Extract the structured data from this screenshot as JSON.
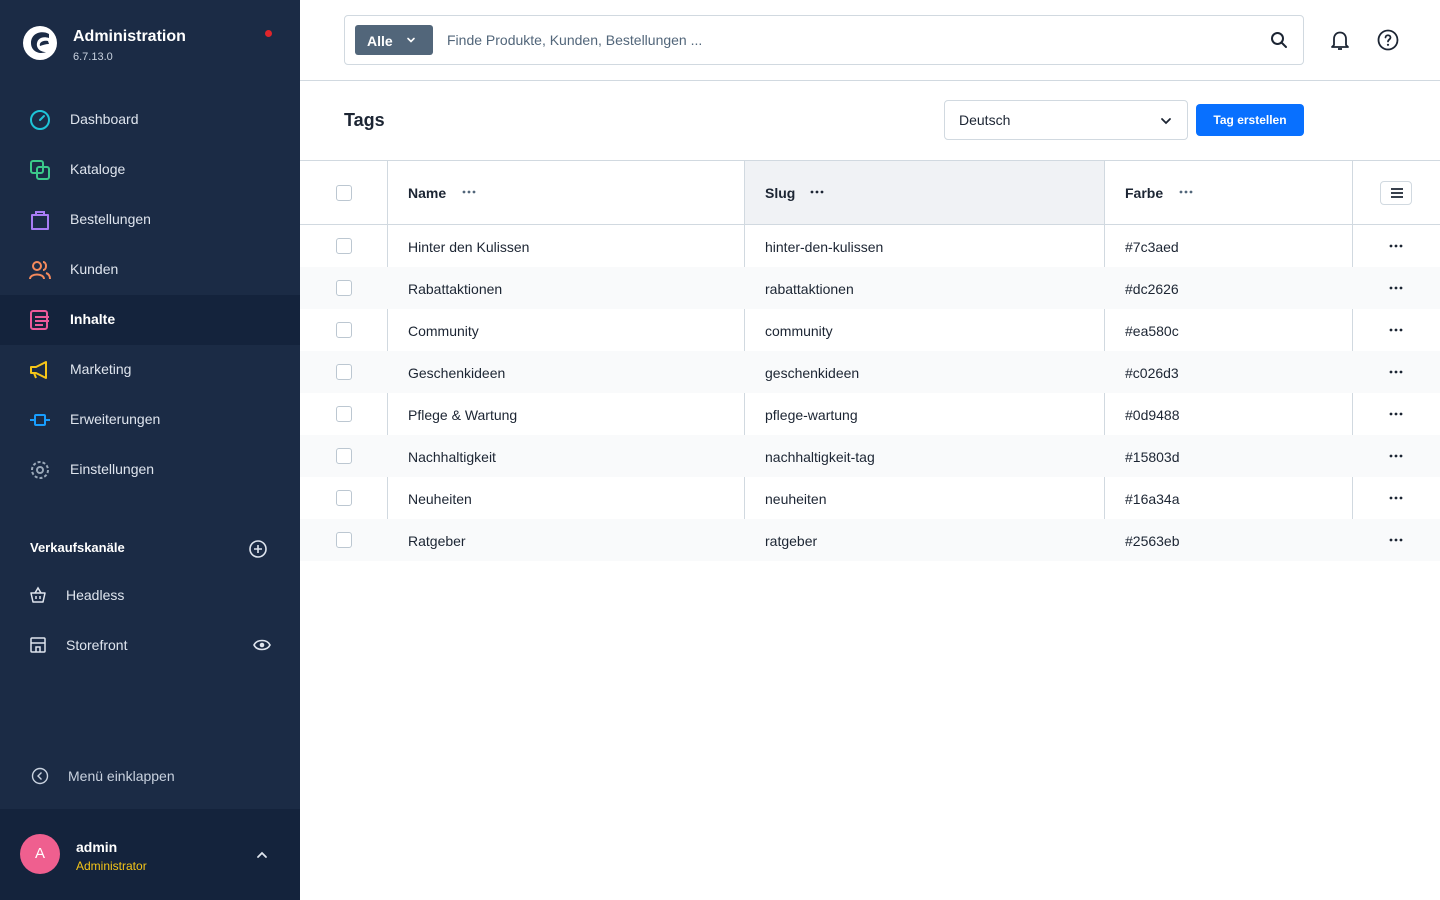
{
  "sidebar": {
    "brand_title": "Administration",
    "brand_version": "6.7.13.0",
    "items": [
      {
        "label": "Dashboard",
        "icon": "dashboard-icon",
        "color": "#1ec4d8"
      },
      {
        "label": "Kataloge",
        "icon": "catalogue-icon",
        "color": "#3bc98a"
      },
      {
        "label": "Bestellungen",
        "icon": "shopping-bag-icon",
        "color": "#a97cf5"
      },
      {
        "label": "Kunden",
        "icon": "users-icon",
        "color": "#f58a5c"
      },
      {
        "label": "Inhalte",
        "icon": "content-icon",
        "color": "#ec5a9a"
      },
      {
        "label": "Marketing",
        "icon": "megaphone-icon",
        "color": "#f5c518"
      },
      {
        "label": "Erweiterungen",
        "icon": "plug-icon",
        "color": "#189eff"
      },
      {
        "label": "Einstellungen",
        "icon": "gear-icon",
        "color": "#9aa8b8"
      }
    ],
    "active_item": "Inhalte",
    "sales_channels_title": "Verkaufskanäle",
    "channels": [
      {
        "label": "Headless",
        "icon": "basket-icon"
      },
      {
        "label": "Storefront",
        "icon": "storefront-icon"
      }
    ],
    "collapse_label": "Menü einklappen",
    "user": {
      "initial": "A",
      "name": "admin",
      "role": "Administrator"
    }
  },
  "search": {
    "type_label": "Alle",
    "placeholder": "Finde Produkte, Kunden, Bestellungen ..."
  },
  "page": {
    "title": "Tags",
    "language": "Deutsch",
    "create_label": "Tag erstellen"
  },
  "grid": {
    "columns": [
      "Name",
      "Slug",
      "Farbe"
    ],
    "rows": [
      {
        "name": "Hinter den Kulissen",
        "slug": "hinter-den-kulissen",
        "color": "#7c3aed"
      },
      {
        "name": "Rabattaktionen",
        "slug": "rabattaktionen",
        "color": "#dc2626"
      },
      {
        "name": "Community",
        "slug": "community",
        "color": "#ea580c"
      },
      {
        "name": "Geschenkideen",
        "slug": "geschenkideen",
        "color": "#c026d3"
      },
      {
        "name": "Pflege & Wartung",
        "slug": "pflege-wartung",
        "color": "#0d9488"
      },
      {
        "name": "Nachhaltigkeit",
        "slug": "nachhaltigkeit-tag",
        "color": "#15803d"
      },
      {
        "name": "Neuheiten",
        "slug": "neuheiten",
        "color": "#16a34a"
      },
      {
        "name": "Ratgeber",
        "slug": "ratgeber",
        "color": "#2563eb"
      }
    ]
  },
  "colors": {
    "sidebar_bg": "#1b2b45",
    "primary": "#0870ff",
    "avatar": "#ef5f8f",
    "user_role": "#f5c518"
  }
}
